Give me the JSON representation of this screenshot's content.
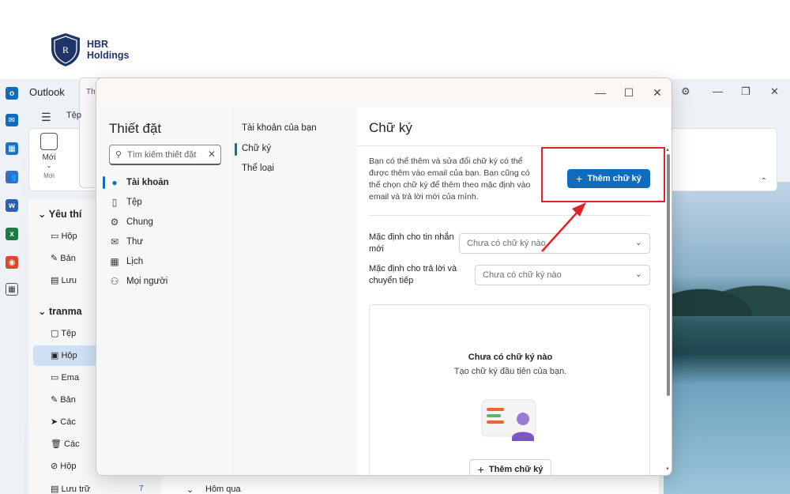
{
  "logo": {
    "line1": "HBR",
    "line2": "Holdings"
  },
  "outlook": {
    "title": "Outlook",
    "ribbon": {
      "new_label": "Mới",
      "group_label": "Mới",
      "tab_file": "Tệp",
      "bg_window_label": "Th"
    },
    "folders": {
      "favorites_head": "Yêu thí",
      "fav_items": [
        "Hộp",
        "Bản",
        "Lưu"
      ],
      "account_head": "tranma",
      "account_items": [
        "Tệp",
        "Hộp",
        "Ema",
        "Bản",
        "Các",
        "Các",
        "Hộp",
        "Lưu trữ"
      ],
      "archive_count": "7"
    },
    "message_list": {
      "group_label": "Hôm qua"
    }
  },
  "settings": {
    "title": "Thiết đặt",
    "search": {
      "placeholder": "Tìm kiếm thiết đặt"
    },
    "nav": [
      {
        "label": "Tài khoản",
        "icon": "person-icon"
      },
      {
        "label": "Tệp",
        "icon": "file-icon"
      },
      {
        "label": "Chung",
        "icon": "gear-icon"
      },
      {
        "label": "Thư",
        "icon": "mail-icon"
      },
      {
        "label": "Lịch",
        "icon": "calendar-icon"
      },
      {
        "label": "Mọi người",
        "icon": "people-icon"
      }
    ],
    "subnav": [
      {
        "label": "Tài khoản của bạn"
      },
      {
        "label": "Chữ ký"
      },
      {
        "label": "Thể loại"
      }
    ],
    "content": {
      "title": "Chữ ký",
      "description": "Bạn có thể thêm và sửa đổi chữ ký có thể được thêm vào email của bạn. Bạn cũng có thể chọn chữ ký để thêm theo mặc định vào email và trả lời mới của mình.",
      "add_button": "Thêm chữ ký",
      "default_new_label": "Mặc định cho tin nhắn mới",
      "default_new_value": "Chưa có chữ ký nào",
      "default_reply_label": "Mặc định cho trả lời và chuyển tiếp",
      "default_reply_value": "Chưa có chữ ký nào",
      "empty_title": "Chưa có chữ ký nào",
      "empty_subtitle": "Tạo chữ ký đầu tiên của bạn.",
      "empty_add_button": "Thêm chữ ký"
    }
  },
  "colors": {
    "accent": "#0f6cbd",
    "highlight": "#e0232a"
  }
}
